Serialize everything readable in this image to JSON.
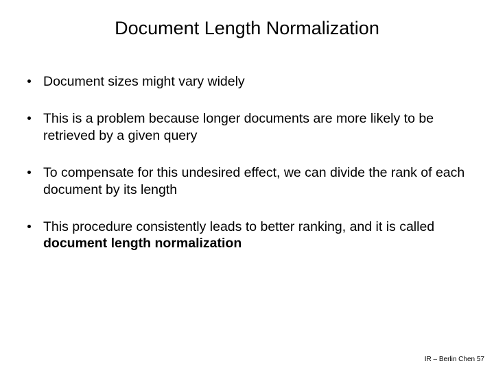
{
  "title": "Document Length Normalization",
  "bullets": {
    "b1": "Document sizes might vary widely",
    "b2": "This is a problem because longer documents are more likely to be retrieved by a given query",
    "b3": "To compensate for this undesired effect, we can divide the rank of each document by its length",
    "b4_prefix": "This procedure consistently leads to better ranking, and it is called ",
    "b4_bold": "document length normalization"
  },
  "footer": "IR – Berlin Chen 57"
}
